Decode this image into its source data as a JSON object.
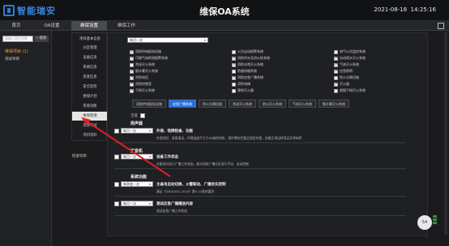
{
  "header": {
    "logo_text": "智能瑞安",
    "title": "维保OA系统",
    "date": "2021-08-18",
    "time": "14:25:16"
  },
  "nav": {
    "items": [
      {
        "label": "首页"
      },
      {
        "label": "OA设置"
      },
      {
        "label": "维保设置"
      },
      {
        "label": "维保工作"
      }
    ],
    "active": "维保设置"
  },
  "sidebar": {
    "search_placeholder": "请输入项目名称",
    "search_button": "搜索",
    "category": "维保项目 (1)",
    "sub": "测试项目"
  },
  "submenu": {
    "items": [
      {
        "label": "项目基本信息"
      },
      {
        "label": "分区管理"
      },
      {
        "label": "设备信息"
      },
      {
        "label": "系统信息"
      },
      {
        "label": "巡查信息"
      },
      {
        "label": "安全巡检"
      },
      {
        "label": "维保计划"
      },
      {
        "label": "系统功能"
      },
      {
        "label": "维保管理"
      },
      {
        "label": "巡查考试"
      },
      {
        "label": "项目资料"
      }
    ],
    "active_index": 8
  },
  "content": {
    "frequency_select": "每月一次",
    "checkboxes": [
      {
        "label": "消防供电配电设施",
        "checked": true
      },
      {
        "label": "火灾自动报警系统",
        "checked": false
      },
      {
        "label": "电气火灾监控系统",
        "checked": false
      },
      {
        "label": "可燃气体探测报警系统",
        "checked": true
      },
      {
        "label": "消防供水及消火栓系统",
        "checked": true
      },
      {
        "label": "自动喷水灭火系统",
        "checked": true
      },
      {
        "label": "泡沫灭火系统",
        "checked": false
      },
      {
        "label": "消防水炮灭火系统",
        "checked": true
      },
      {
        "label": "气体灭火系统",
        "checked": true
      },
      {
        "label": "细水雾灭火系统",
        "checked": true
      },
      {
        "label": "防烟排烟系统",
        "checked": false
      },
      {
        "label": "应急照明",
        "checked": true
      },
      {
        "label": "消防电话",
        "checked": true
      },
      {
        "label": "消防应急广播系统",
        "checked": true
      },
      {
        "label": "防火分隔设施",
        "checked": false
      },
      {
        "label": "消防控制室",
        "checked": true
      },
      {
        "label": "消防电梯",
        "checked": false
      },
      {
        "label": "灭火器",
        "checked": true
      },
      {
        "label": "干粉灭火系统",
        "checked": true
      },
      {
        "label": "建筑灭火器",
        "checked": false
      },
      {
        "label": "超细干粉灭火系统",
        "checked": false
      }
    ],
    "tabs": [
      {
        "label": "消防供电配电设施"
      },
      {
        "label": "应急广播系统"
      },
      {
        "label": "防火分隔设施"
      },
      {
        "label": "泡沫灭火系统"
      },
      {
        "label": "防火灭火系统"
      },
      {
        "label": "气体灭火系统"
      },
      {
        "label": "细水雾灭火系统"
      }
    ],
    "active_tab": 1,
    "select_all": "全选",
    "section1": "扬声器",
    "item1_select": "每月一次",
    "item1_title": "外观、铭牌检查、功能",
    "item1_desc": "外观完好、表面清洁，环境温度不大于60度的场所，保护罩应完整且固定牢靠，应能正常运转而无异常响声",
    "section2": "扩音机",
    "item2_select": "每月一次",
    "item2_title": "设备工作状态",
    "item2_desc": "应能实时显示广播工作状态，能对消防广播分区进行手动、自动控制",
    "section3": "系统功能",
    "item3_select": "每季度一次",
    "item3_title": "主备电自动切换、火警联动、广播优先控制",
    "item3_desc": "满足《GB25201-2010》第5.14条的要求",
    "item4_select": "每月一次",
    "item4_title": "测试应急广播播放内容",
    "item4_desc": "测试应急广播工作状态",
    "inspect_label": "检查项目:"
  },
  "badge": "54"
}
